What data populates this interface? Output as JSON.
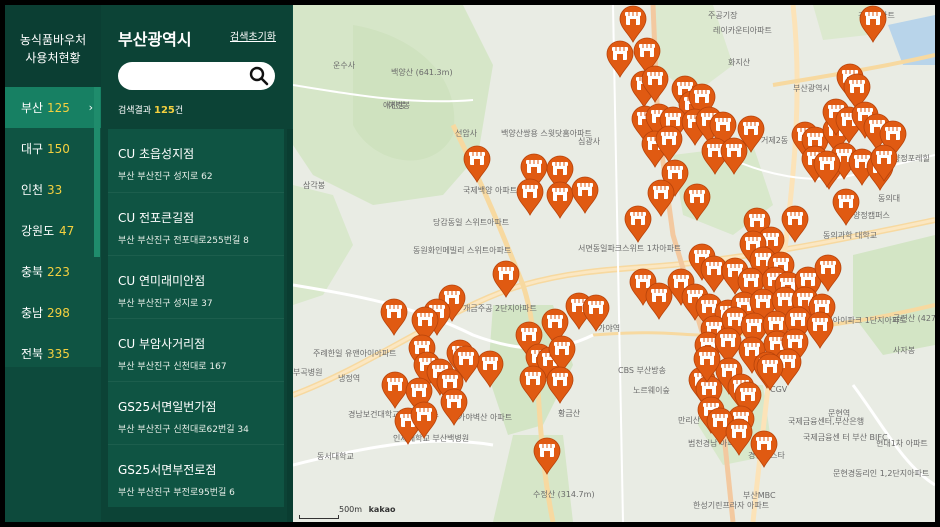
{
  "app": {
    "title_line1": "농식품바우처",
    "title_line2": "사용처현황"
  },
  "regions": [
    {
      "name": "부산",
      "count": "125",
      "active": true
    },
    {
      "name": "대구",
      "count": "150"
    },
    {
      "name": "인천",
      "count": "33"
    },
    {
      "name": "강원도",
      "count": "47"
    },
    {
      "name": "충북",
      "count": "223"
    },
    {
      "name": "충남",
      "count": "298"
    },
    {
      "name": "전북",
      "count": "335"
    }
  ],
  "panel": {
    "title": "부산광역시",
    "reset_label": "검색초기화",
    "search_placeholder": "",
    "result_prefix": "검색결과",
    "result_count": "125",
    "result_suffix": "건"
  },
  "results": [
    {
      "name": "CU 초읍성지점",
      "address": "부산 부산진구 성지로 62"
    },
    {
      "name": "CU 전포큰길점",
      "address": "부산 부산진구 전포대로255번길 8"
    },
    {
      "name": "CU 연미래미안점",
      "address": "부산 부산진구 성지로 37"
    },
    {
      "name": "CU 부암사거리점",
      "address": "부산 부산진구 신천대로 167"
    },
    {
      "name": "GS25서면일번가점",
      "address": "부산 부산진구 신천대로62번길 34"
    },
    {
      "name": "GS25서면부전로점",
      "address": "부산 부산진구 부전로95번길 6"
    }
  ],
  "map": {
    "scale_label": "500m",
    "provider": "kakao",
    "pin_color": "#e05a12",
    "labels": [
      "운수사",
      "백양산 (641.3m)",
      "애진봉",
      "선암사",
      "백양산쌍용 스윗닷홈아파트",
      "심광사",
      "삼각봉",
      "국제백양 아파트",
      "당감동일 스위트아파트",
      "동원화인메빌리 스위트아파트",
      "개금주공 2단지아파트",
      "주례한일 유앤아이아파트",
      "부곡병원",
      "냉정역",
      "경남보건대학교 냉정캠퍼스",
      "인제대학교 부산백병원",
      "가야벽산 아파트",
      "동서대학교",
      "황금산",
      "수정산 (314.7m)",
      "CBS 부산방송",
      "노르웨이숲",
      "만리산 (420.4m)",
      "범천경남 아파트",
      "서면동일파크스위트 1차아파트",
      "가야역",
      "부산광역시",
      "레이카운티아파트",
      "화지산",
      "동의과학 대학교",
      "양정캠퍼스",
      "금련산 (427m)",
      "사자봉",
      "국제금융센터,부산은행",
      "국제금융센 터 부산 BIFC",
      "문현경동리인 1,2단지아파트",
      "현대1차 아파트",
      "부산MBC",
      "한성기린프라자 아파트",
      "경남비스타",
      "주공기장",
      "경남아파트",
      "애진봉",
      "서면아이파크 1단지아파트",
      "문현역",
      "CGV",
      "동의대",
      "양정포레힐",
      "거제2동"
    ]
  }
}
